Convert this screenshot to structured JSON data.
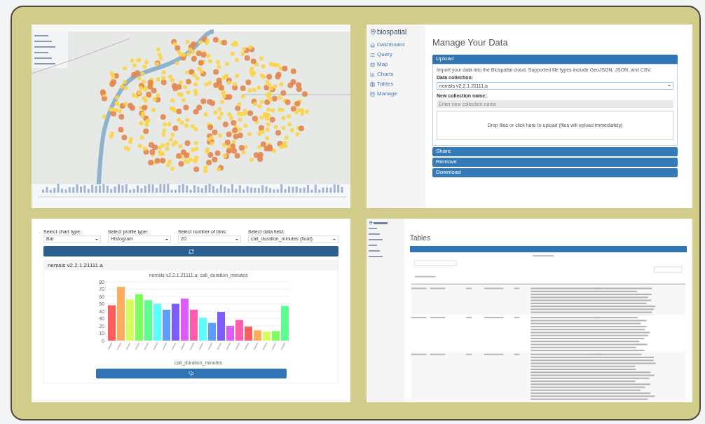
{
  "manage_screen": {
    "logo": "biospatial",
    "nav": [
      "Dashboard",
      "Query",
      "Map",
      "Charts",
      "Tables",
      "Manage"
    ],
    "title": "Manage Your Data",
    "sections": [
      {
        "label": "Upload",
        "expanded": true
      },
      {
        "label": "Share",
        "expanded": false
      },
      {
        "label": "Remove",
        "expanded": false
      },
      {
        "label": "Download",
        "expanded": false
      }
    ],
    "upload": {
      "intro": "Import your data into the Biospatial cloud. Supported file types include GeoJSON, JSON, and CSV.",
      "collection_label": "Data collection:",
      "collection_value": "nemsis v2.2.1.21111.a",
      "name_label": "New collection name:",
      "name_placeholder": "Enter new collection name",
      "dropzone": "Drop files or click here to upload (files will upload immediately)"
    }
  },
  "chart_screen": {
    "selects": [
      {
        "label": "Select chart type:",
        "value": "Bar"
      },
      {
        "label": "Select profile type:",
        "value": "Histogram"
      },
      {
        "label": "Select number of bins:",
        "value": "20"
      },
      {
        "label": "Select data field:",
        "value": "call_duration_minutes (float)"
      }
    ],
    "panel_title": "nemsis v2.2.1.21111.a",
    "chart_data": {
      "type": "bar",
      "title": "nemsis v2.2.1.21111.a: call_duration_minutes",
      "xlabel": "call_duration_minutes",
      "ylim": [
        0,
        80
      ],
      "yticks": [
        0,
        10,
        20,
        30,
        40,
        50,
        60,
        70,
        80
      ],
      "grid": true,
      "series": [
        {
          "values": [
            48,
            73,
            56,
            63,
            55,
            50,
            42,
            50,
            57,
            42,
            31,
            24,
            39,
            20,
            28,
            19,
            14,
            12,
            13,
            47
          ]
        }
      ],
      "colors": [
        "#ff5c5c",
        "#ffad5c",
        "#d6ff5c",
        "#7dff5c",
        "#5cff8f",
        "#5cffff",
        "#5c9dff",
        "#7d5cff",
        "#de5cff",
        "#ff5cad",
        "#5cffff",
        "#5c9dff",
        "#7d5cff",
        "#de5cff",
        "#ff5cad",
        "#ff5c5c",
        "#ffad5c",
        "#d6ff5c",
        "#7dff5c",
        "#5cff8f"
      ]
    }
  },
  "tables_screen": {
    "title": "Tables"
  }
}
